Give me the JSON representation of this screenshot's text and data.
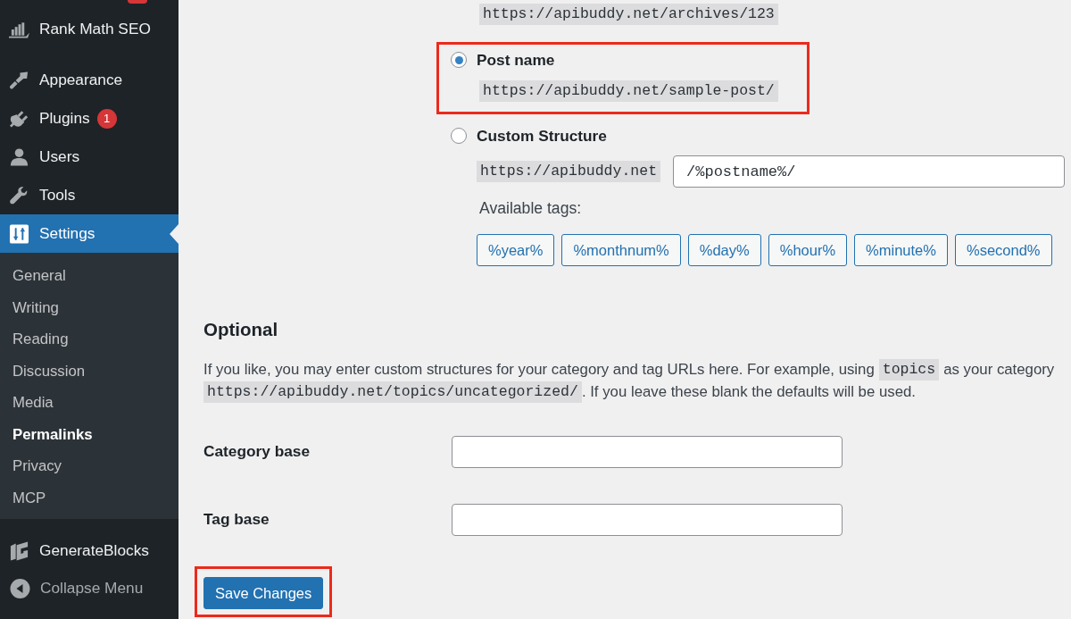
{
  "sidebar": {
    "clipped_badge": true,
    "menu_groups": [
      [
        {
          "label": "Rank Math SEO",
          "selected": false
        }
      ],
      [
        {
          "label": "Appearance",
          "selected": false
        },
        {
          "label": "Plugins",
          "selected": false,
          "badge": "1"
        },
        {
          "label": "Users",
          "selected": false
        },
        {
          "label": "Tools",
          "selected": false
        },
        {
          "label": "Settings",
          "selected": true,
          "children": [
            {
              "label": "General",
              "selected": false
            },
            {
              "label": "Writing",
              "selected": false
            },
            {
              "label": "Reading",
              "selected": false
            },
            {
              "label": "Discussion",
              "selected": false
            },
            {
              "label": "Media",
              "selected": false
            },
            {
              "label": "Permalinks",
              "selected": true
            },
            {
              "label": "Privacy",
              "selected": false
            },
            {
              "label": "MCP",
              "selected": false
            }
          ]
        },
        {
          "label": "GenerateBlocks",
          "selected": false
        }
      ]
    ],
    "collapse_label": "Collapse Menu"
  },
  "permalink_settings": {
    "clipped_example": "https://apibuddy.net/archives/123",
    "options": [
      {
        "kind": "preset",
        "label": "Post name",
        "selected": true,
        "highlighted": true,
        "example": "https://apibuddy.net/sample-post/"
      },
      {
        "kind": "custom",
        "label": "Custom Structure",
        "selected": false,
        "highlighted": false,
        "prefix": "https://apibuddy.net",
        "value": "/%postname%/",
        "tags_label": "Available tags:",
        "tags": [
          "%year%",
          "%monthnum%",
          "%day%",
          "%hour%",
          "%minute%",
          "%second%"
        ]
      }
    ]
  },
  "optional": {
    "heading": "Optional",
    "description_lines": [
      [
        {
          "kind": "text",
          "text": "If you like, you may enter custom structures for your category and tag URLs here. For example, using"
        },
        {
          "kind": "code",
          "text": "topics"
        },
        {
          "kind": "text",
          "text": "as your category"
        }
      ],
      [
        {
          "kind": "code",
          "text": "https://apibuddy.net/topics/uncategorized/"
        },
        {
          "kind": "text",
          "text": ". If you leave these blank the defaults will be used."
        }
      ]
    ],
    "fields": [
      {
        "label": "Category base"
      },
      {
        "label": "Tag base"
      }
    ]
  },
  "save_button": {
    "label": "Save Changes",
    "highlighted": true
  }
}
